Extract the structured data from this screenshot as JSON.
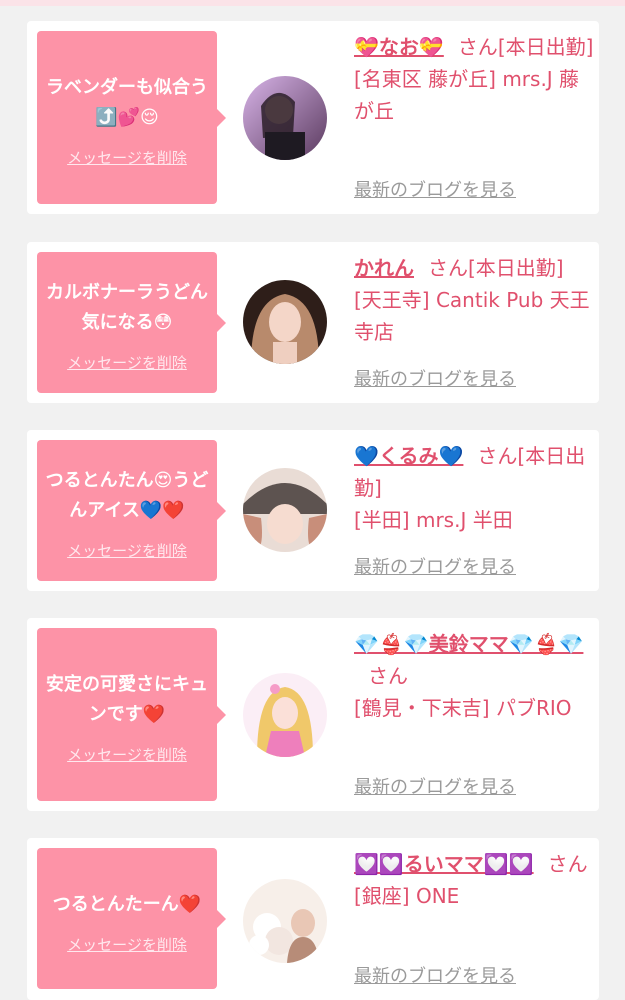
{
  "delete_label": "メッセージを削除",
  "blog_label": "最新のブログを見る",
  "san_label": "さん",
  "items": [
    {
      "message": "ラベンダーも似合う⤴️💕😌",
      "name": "💝なお💝",
      "status": "[本日出勤]",
      "location": "[名東区 藤が丘] mrs.J 藤が丘",
      "avatar_colors": [
        "#b995c8",
        "#3a2a3a"
      ]
    },
    {
      "message": "カルボナーラうどん気になる😳",
      "name": "かれん",
      "status": "[本日出勤]",
      "location": "[天王寺] Cantik Pub 天王寺店",
      "avatar_colors": [
        "#a0725c",
        "#2e1e19"
      ]
    },
    {
      "message": "つるとんたん😍うどんアイス💙❤️",
      "name": "💙くるみ💙",
      "status": "[本日出勤]",
      "location": "[半田] mrs.J 半田",
      "avatar_colors": [
        "#7a6f6a",
        "#e9c9bb"
      ]
    },
    {
      "message": "安定の可愛さにキュンです❤️",
      "name": "💎👙💎美鈴ママ💎👙💎",
      "status": "",
      "location": "[鶴見・下末吉] パブRIO",
      "avatar_colors": [
        "#f2d3e6",
        "#e579b4"
      ]
    },
    {
      "message": "つるとんたーん❤️",
      "name": "💟💟るいママ💟💟",
      "status": "",
      "location": "[銀座] ONE",
      "avatar_colors": [
        "#f6ece6",
        "#b78c78"
      ]
    }
  ]
}
